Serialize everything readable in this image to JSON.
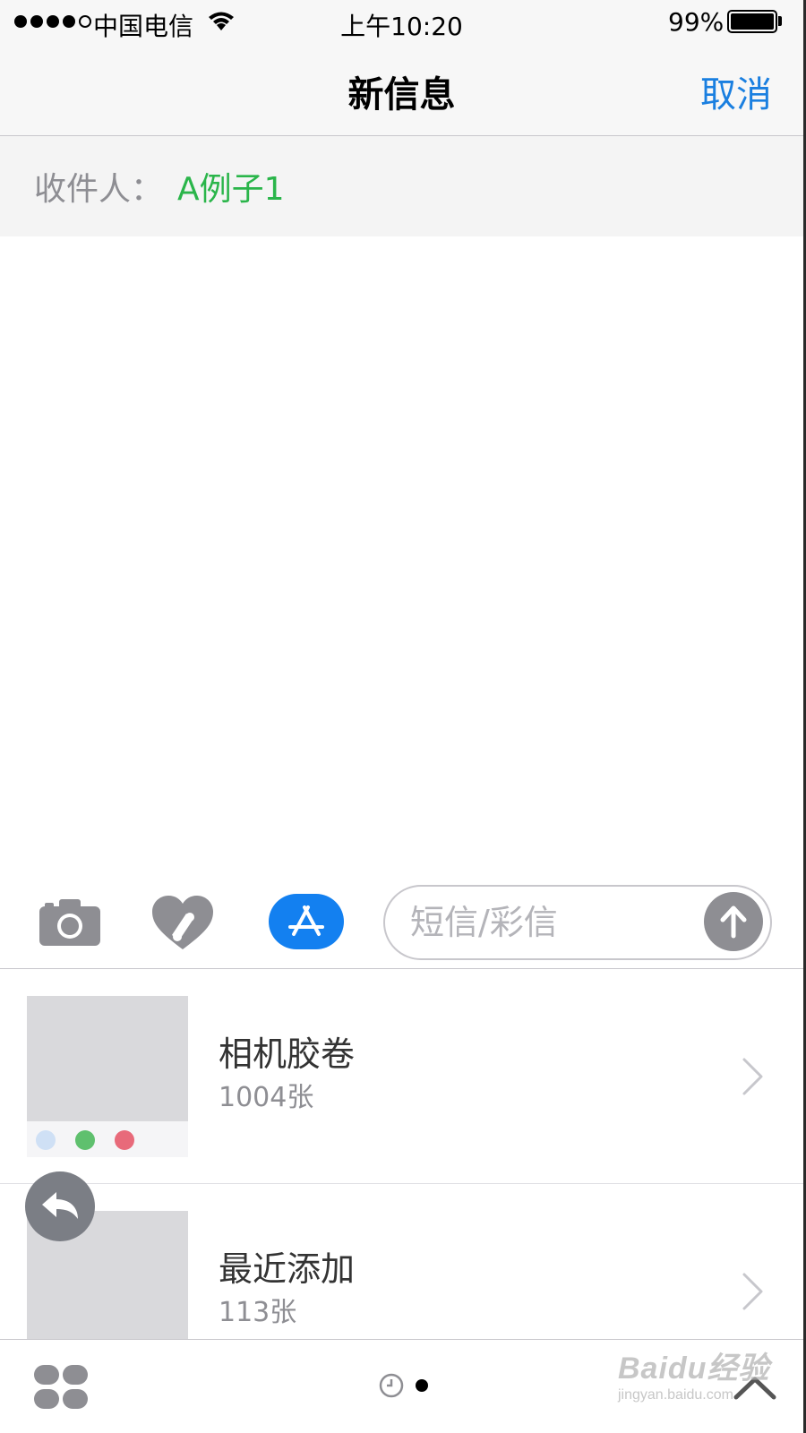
{
  "status_bar": {
    "carrier": "中国电信",
    "time": "上午10:20",
    "battery_percent": "99%",
    "signal_bars_filled": 4,
    "signal_bars_total": 5,
    "battery_level": 0.99
  },
  "nav": {
    "title": "新信息",
    "cancel_label": "取消"
  },
  "recipient": {
    "label": "收件人：",
    "value": "A例子1"
  },
  "composer": {
    "placeholder": "短信/彩信",
    "camera_icon": "camera-icon",
    "digital_touch_icon": "digital-touch-heart-icon",
    "app_store_icon": "app-store-icon",
    "send_icon": "send-arrow-up-icon"
  },
  "albums": [
    {
      "name": "相机胶卷",
      "count": "1004张"
    },
    {
      "name": "最近添加",
      "count": "113张"
    }
  ],
  "bottom_bar": {
    "apps_icon": "app-drawer-icon",
    "recent_icon": "clock-icon",
    "expand_icon": "chevron-up-icon"
  },
  "watermark": {
    "main": "Baidu经验",
    "sub": "jingyan.baidu.com"
  },
  "colors": {
    "accent_blue": "#1a7fe0",
    "recipient_green": "#2ab54a",
    "app_store_blue": "#1380f0",
    "send_gray": "#8e8e93"
  }
}
